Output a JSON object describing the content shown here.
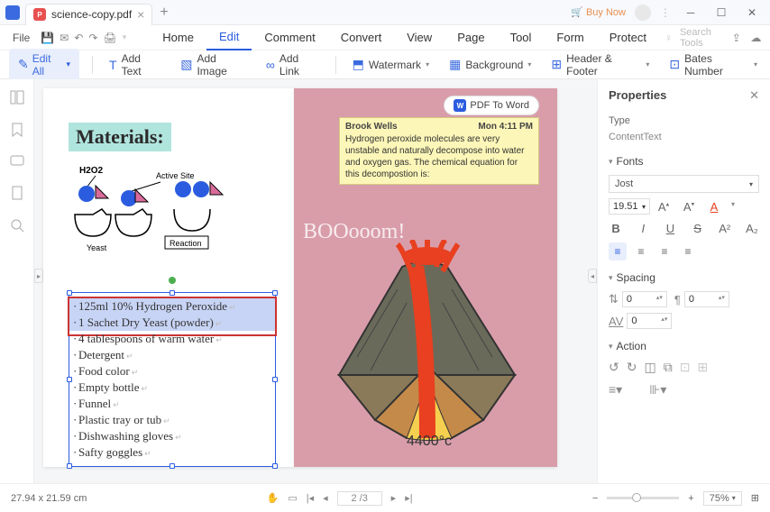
{
  "titlebar": {
    "tab_title": "science-copy.pdf",
    "buy_now": "Buy Now"
  },
  "menubar": {
    "file": "File",
    "tabs": [
      "Home",
      "Edit",
      "Comment",
      "Convert",
      "View",
      "Page",
      "Tool",
      "Form",
      "Protect"
    ],
    "active_tab": 1,
    "search_placeholder": "Search Tools"
  },
  "toolbar": {
    "edit_all": "Edit All",
    "add_text": "Add Text",
    "add_image": "Add Image",
    "add_link": "Add Link",
    "watermark": "Watermark",
    "background": "Background",
    "header_footer": "Header & Footer",
    "bates_number": "Bates Number"
  },
  "document": {
    "materials_header": "Materials:",
    "diagram_labels": {
      "h2o2": "H2O2",
      "active_site": "Active Site",
      "yeast": "Yeast",
      "reaction": "Reaction"
    },
    "list_items": [
      {
        "text": "125ml 10% Hydrogen Peroxide",
        "highlighted": true
      },
      {
        "text": "1 Sachet Dry Yeast (powder)",
        "highlighted": true
      },
      {
        "text": "4 tablespoons of warm water",
        "highlighted": false
      },
      {
        "text": "Detergent",
        "highlighted": false
      },
      {
        "text": "Food color",
        "highlighted": false
      },
      {
        "text": "Empty bottle",
        "highlighted": false
      },
      {
        "text": "Funnel",
        "highlighted": false
      },
      {
        "text": "Plastic tray or tub",
        "highlighted": false
      },
      {
        "text": "Dishwashing gloves",
        "highlighted": false
      },
      {
        "text": "Safty goggles",
        "highlighted": false
      }
    ],
    "pdf_to_word": "PDF To Word",
    "note": {
      "author": "Brook Wells",
      "time": "Mon 4:11 PM",
      "body": "Hydrogen peroxide molecules are very unstable and naturally decompose into water and oxygen gas. The chemical equation for this decompostion is:"
    },
    "boom_text": "BOOooom!",
    "temp": "4400°c"
  },
  "properties": {
    "title": "Properties",
    "type_label": "Type",
    "type_value": "ContentText",
    "fonts_section": "Fonts",
    "font_family": "Jost",
    "font_size": "19.51",
    "spacing_section": "Spacing",
    "spacing_values": {
      "line": "0",
      "para": "0",
      "char": "0"
    },
    "action_section": "Action"
  },
  "statusbar": {
    "dimensions": "27.94 x 21.59 cm",
    "page": "2 /3",
    "zoom": "75%"
  }
}
